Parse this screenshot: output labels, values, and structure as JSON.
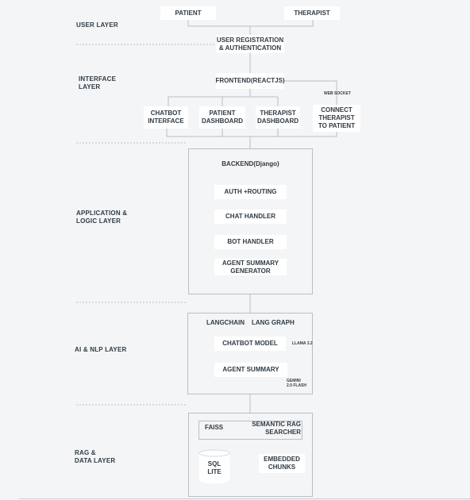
{
  "layers": {
    "user": "USER LAYER",
    "interface": "INTERFACE\nLAYER",
    "application": "APPLICATION &\nLOGIC LAYER",
    "ai": "AI & NLP LAYER",
    "rag": "RAG &\nDATA LAYER"
  },
  "user_layer": {
    "patient": "PATIENT",
    "therapist": "THERAPIST",
    "registration": "USER REGISTRATION\n& AUTHENTICATION"
  },
  "interface_layer": {
    "frontend": "FRONTEND(REACTJS)",
    "websocket": "WEB SOCKET",
    "chatbot_interface": "CHATBOT\nINTERFACE",
    "patient_dashboard": "PATIENT\nDASHBOARD",
    "therapist_dashboard": "THERAPIST\nDASHBOARD",
    "connect": "CONNECT\nTHERAPIST\nTO PATIENT"
  },
  "application_layer": {
    "backend": "BACKEND(Django)",
    "auth": "AUTH +ROUTING",
    "chat_handler": "CHAT HANDLER",
    "bot_handler": "BOT HANDLER",
    "agent_summary_generator": "AGENT SUMMARY\nGENERATOR"
  },
  "ai_layer": {
    "langchain": "LANGCHAIN",
    "langgraph": "LANG GRAPH",
    "chatbot_model": "CHATBOT MODEL",
    "llama": "LLAMA 3.2",
    "agent_summary": "AGENT SUMMARY",
    "gemini": "GEMINI\n2.0 FLASH"
  },
  "rag_layer": {
    "faiss": "FAISS",
    "semantic": "SEMANTIC RAG\nSEARCHER",
    "sqlite": "SQL\nLITE",
    "embedded": "EMBEDDED\nCHUNKS"
  },
  "colors": {
    "background": "#f4f5f6",
    "box": "#ffffff",
    "line": "#b8c0c6",
    "text": "#2f3b44"
  }
}
